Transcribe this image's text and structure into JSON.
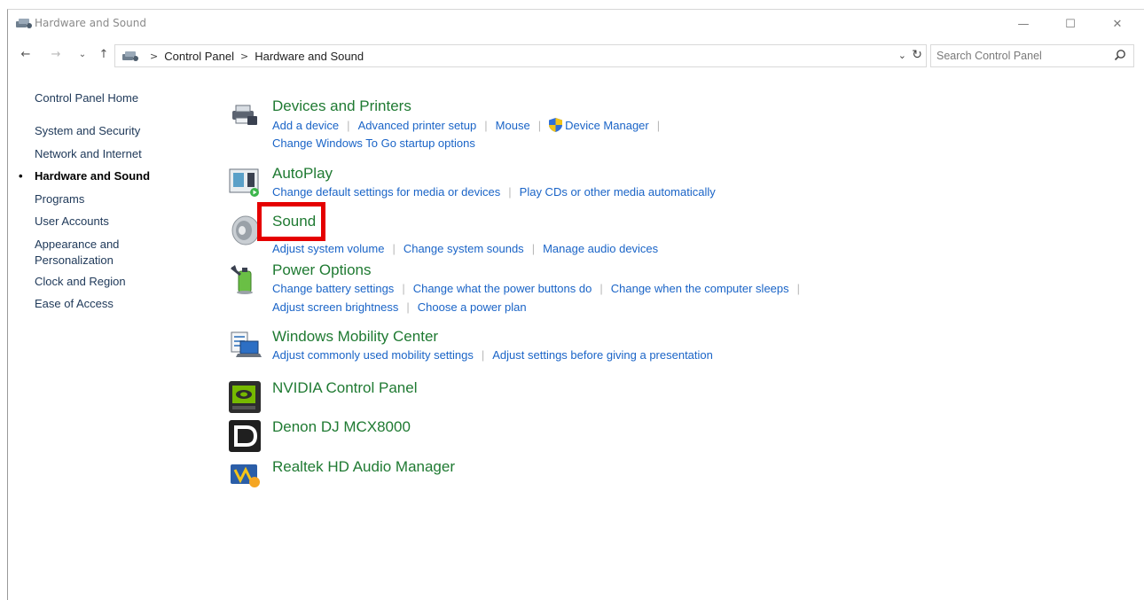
{
  "window": {
    "title": "Hardware and Sound",
    "controls": {
      "minimize": "—",
      "maximize": "☐",
      "close": "✕"
    }
  },
  "nav": {
    "back": "←",
    "forward": "→",
    "recent": "⌄",
    "up": "↑",
    "breadcrumbs": [
      "Control Panel",
      "Hardware and Sound"
    ],
    "search_placeholder": "Search Control Panel"
  },
  "leftnav": {
    "home": "Control Panel Home",
    "items": [
      {
        "label": "System and Security"
      },
      {
        "label": "Network and Internet"
      },
      {
        "label": "Hardware and Sound",
        "active": true
      },
      {
        "label": "Programs"
      },
      {
        "label": "User Accounts"
      },
      {
        "label": "Appearance and"
      },
      {
        "label": "Personalization"
      },
      {
        "label": "Clock and Region"
      },
      {
        "label": "Ease of Access"
      }
    ]
  },
  "categories": [
    {
      "title": "Devices and Printers",
      "icon": "printer-icon",
      "links_row1": [
        "Add a device",
        "Advanced printer setup",
        "Mouse",
        "Device Manager"
      ],
      "links_row2": [
        "Change Windows To Go startup options"
      ]
    },
    {
      "title": "AutoPlay",
      "icon": "autoplay-icon",
      "links_row1": [
        "Change default settings for media or devices",
        "Play CDs or other media automatically"
      ]
    },
    {
      "title": "Sound",
      "icon": "speaker-icon",
      "links_row1": [
        "Adjust system volume",
        "Change system sounds",
        "Manage audio devices"
      ]
    },
    {
      "title": "Power Options",
      "icon": "power-icon",
      "links_row1": [
        "Change battery settings",
        "Change what the power buttons do",
        "Change when the computer sleeps"
      ],
      "links_row2": [
        "Adjust screen brightness",
        "Choose a power plan"
      ]
    },
    {
      "title": "Windows Mobility Center",
      "icon": "mobility-icon",
      "links_row1": [
        "Adjust commonly used mobility settings",
        "Adjust settings before giving a presentation"
      ]
    },
    {
      "title": "NVIDIA Control Panel",
      "icon": "nvidia-icon"
    },
    {
      "title": "Denon DJ MCX8000",
      "icon": "denon-icon"
    },
    {
      "title": "Realtek HD Audio Manager",
      "icon": "realtek-icon"
    }
  ],
  "colors": {
    "heading_green": "#1f7a32",
    "link_blue": "#1a64c7",
    "highlight_red": "#e50000"
  }
}
